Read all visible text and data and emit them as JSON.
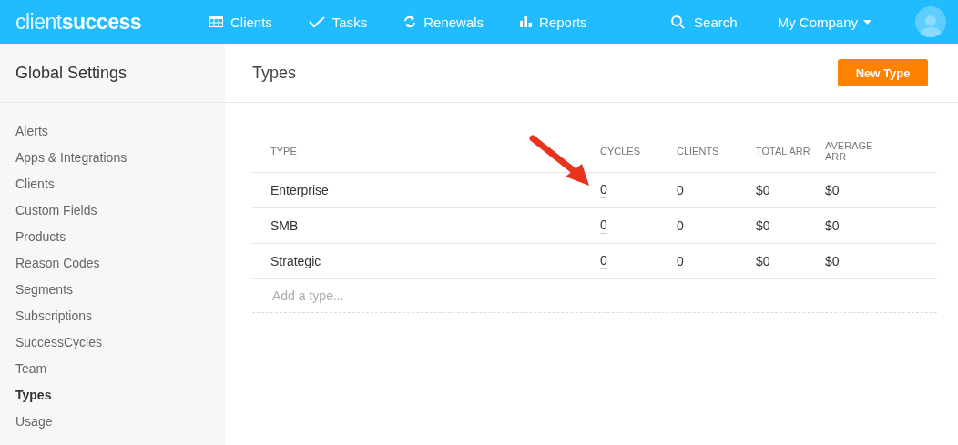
{
  "header": {
    "logo": "client**success**",
    "nav": [
      {
        "label": "Clients"
      },
      {
        "label": "Tasks"
      },
      {
        "label": "Renewals"
      },
      {
        "label": "Reports"
      }
    ],
    "search": "Search",
    "company": "My Company"
  },
  "sidebar": {
    "title": "Global Settings",
    "items": [
      {
        "label": "Alerts",
        "selected": false
      },
      {
        "label": "Apps & Integrations",
        "selected": false
      },
      {
        "label": "Clients",
        "selected": false
      },
      {
        "label": "Custom Fields",
        "selected": false
      },
      {
        "label": "Products",
        "selected": false
      },
      {
        "label": "Reason Codes",
        "selected": false
      },
      {
        "label": "Segments",
        "selected": false
      },
      {
        "label": "Subscriptions",
        "selected": false
      },
      {
        "label": "SuccessCycles",
        "selected": false
      },
      {
        "label": "Team",
        "selected": false
      },
      {
        "label": "Types",
        "selected": true
      },
      {
        "label": "Usage",
        "selected": false
      }
    ]
  },
  "main": {
    "title": "Types",
    "new_button": "New Type",
    "table": {
      "columns": [
        "TYPE",
        "CYCLES",
        "CLIENTS",
        "TOTAL ARR",
        "AVERAGE ARR"
      ],
      "rows": [
        [
          "Enterprise",
          "0",
          "0",
          "$0",
          "$0"
        ],
        [
          "SMB",
          "0",
          "0",
          "$0",
          "$0"
        ],
        [
          "Strategic",
          "0",
          "0",
          "$0",
          "$0"
        ]
      ],
      "add_placeholder": "Add a type..."
    }
  }
}
